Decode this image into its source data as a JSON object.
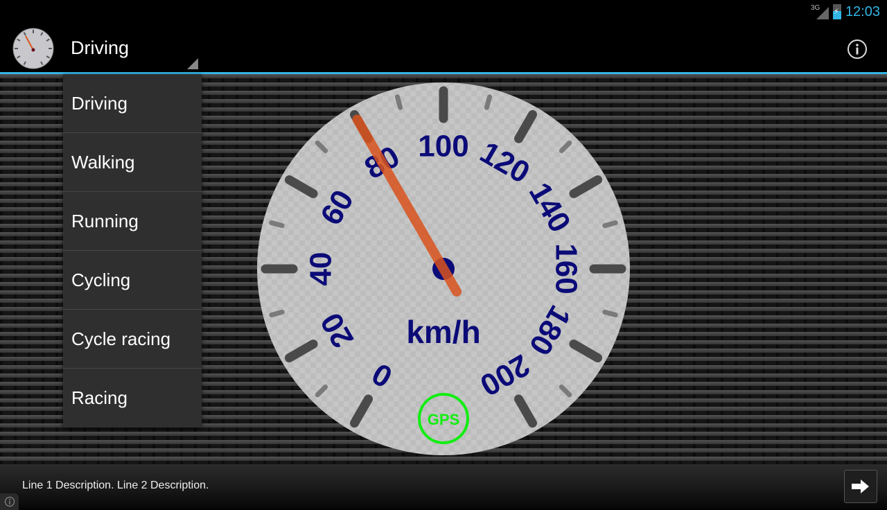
{
  "status_bar": {
    "network": "3G",
    "battery_icon": "battery-charging-icon",
    "time": "12:03",
    "accent_color": "#33b5e5"
  },
  "action_bar": {
    "app_icon": "speedometer-icon",
    "selected_mode": "Driving",
    "info_icon": "info-icon"
  },
  "mode_menu": {
    "items": [
      {
        "label": "Driving"
      },
      {
        "label": "Walking"
      },
      {
        "label": "Running"
      },
      {
        "label": "Cycling"
      },
      {
        "label": "Cycle racing"
      },
      {
        "label": "Racing"
      }
    ]
  },
  "gauge": {
    "unit": "km/h",
    "min": 0,
    "max": 200,
    "major_step": 20,
    "minor_step": 10,
    "speed": 80,
    "labels": [
      "0",
      "20",
      "40",
      "60",
      "80",
      "100",
      "120",
      "140",
      "160",
      "180",
      "200"
    ],
    "gps_label": "GPS",
    "gps_color": "#11ee11",
    "needle_color": "#d9531e",
    "label_color": "#0b0b78",
    "face_color": "#c4c4c4"
  },
  "bottom_bar": {
    "description": "Line 1 Description. Line 2 Description.",
    "next_icon": "arrow-right-icon",
    "small_info_icon": "info-icon"
  }
}
